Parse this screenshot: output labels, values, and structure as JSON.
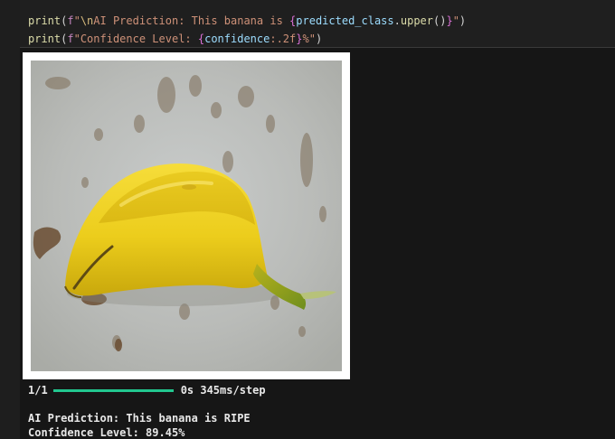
{
  "code": {
    "line1": {
      "fn": "print",
      "open": "(",
      "prefix": "f",
      "str_start": "\"",
      "escape": "\\n",
      "text": "AI Prediction: This banana is ",
      "brace_open": "{",
      "var": "predicted_class",
      "dot": ".",
      "method": "upper",
      "call": "()",
      "brace_close": "}",
      "str_end": "\"",
      "close": ")"
    },
    "line2": {
      "fn": "print",
      "open": "(",
      "prefix": "f",
      "str_start": "\"",
      "text": "Confidence Level: ",
      "brace_open": "{",
      "var": "confidence",
      "format": ":.2f",
      "brace_close": "}",
      "text_end": "%\"",
      "close": ")"
    }
  },
  "output": {
    "image_subject": "banana",
    "progress": {
      "steps": "1/1",
      "fraction": 1.0,
      "timing": "0s 345ms/step"
    },
    "prediction_line": "AI Prediction: This banana is RIPE",
    "confidence_line": "Confidence Level: 89.45%"
  },
  "colors": {
    "progress_bar": "#22c78f",
    "background": "#161616"
  }
}
